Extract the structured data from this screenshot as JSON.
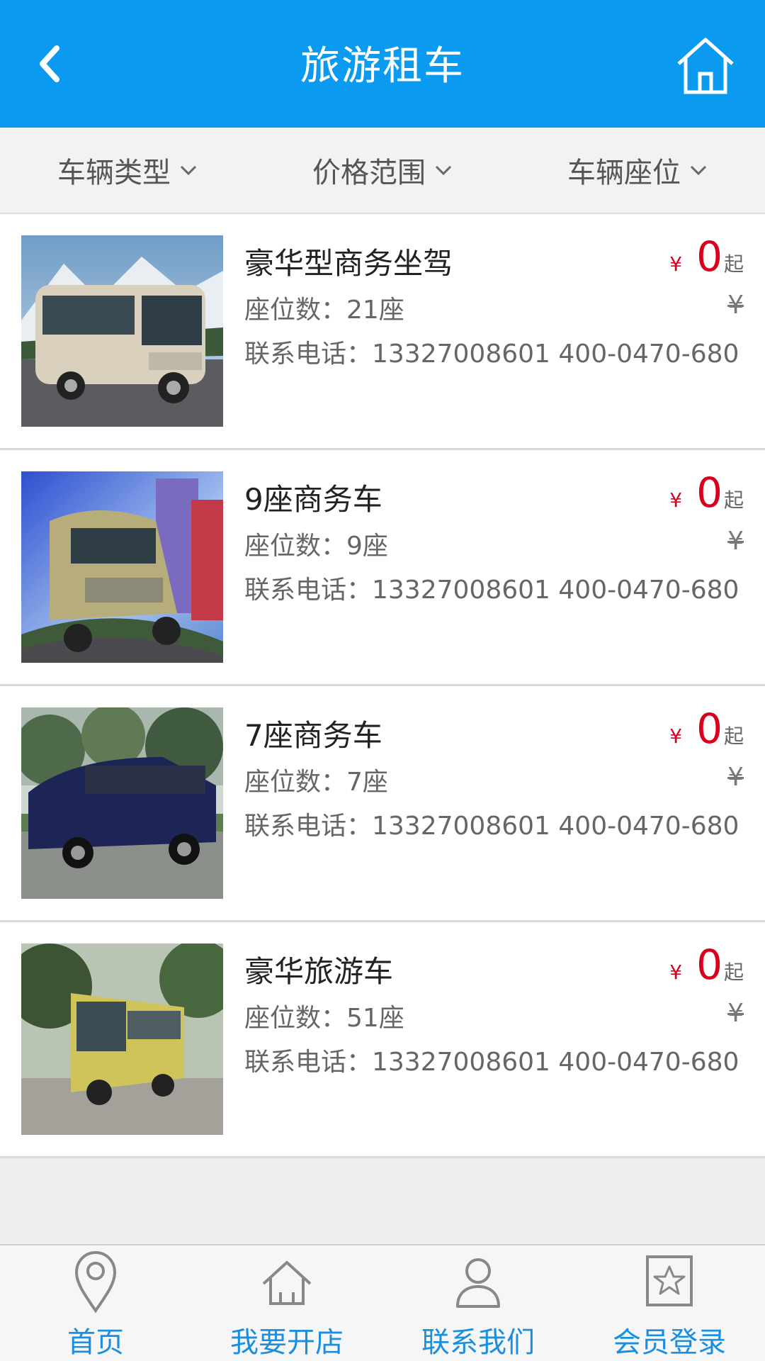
{
  "header": {
    "title": "旅游租车",
    "back_icon": "chevron-left-icon",
    "home_icon": "home-icon",
    "bg_color": "#0a9af0"
  },
  "filters": [
    {
      "label": "车辆类型"
    },
    {
      "label": "价格范围"
    },
    {
      "label": "车辆座位"
    }
  ],
  "items": [
    {
      "name": "豪华型商务坐驾",
      "seats": "座位数：21座",
      "phone": "联系电话：13327008601 400-0470-680",
      "currency": "¥",
      "price": "0",
      "suffix": "起",
      "orig_price": "¥"
    },
    {
      "name": "9座商务车",
      "seats": "座位数：9座",
      "phone": "联系电话：13327008601 400-0470-680",
      "currency": "¥",
      "price": "0",
      "suffix": "起",
      "orig_price": "¥"
    },
    {
      "name": "7座商务车",
      "seats": "座位数：7座",
      "phone": "联系电话：13327008601 400-0470-680",
      "currency": "¥",
      "price": "0",
      "suffix": "起",
      "orig_price": "¥"
    },
    {
      "name": "豪华旅游车",
      "seats": "座位数：51座",
      "phone": "联系电话：13327008601 400-0470-680",
      "currency": "¥",
      "price": "0",
      "suffix": "起",
      "orig_price": "¥"
    }
  ],
  "bottom_nav": [
    {
      "label": "首页",
      "icon": "map-pin-icon"
    },
    {
      "label": "我要开店",
      "icon": "home-icon"
    },
    {
      "label": "联系我们",
      "icon": "user-icon"
    },
    {
      "label": "会员登录",
      "icon": "star-icon"
    }
  ]
}
